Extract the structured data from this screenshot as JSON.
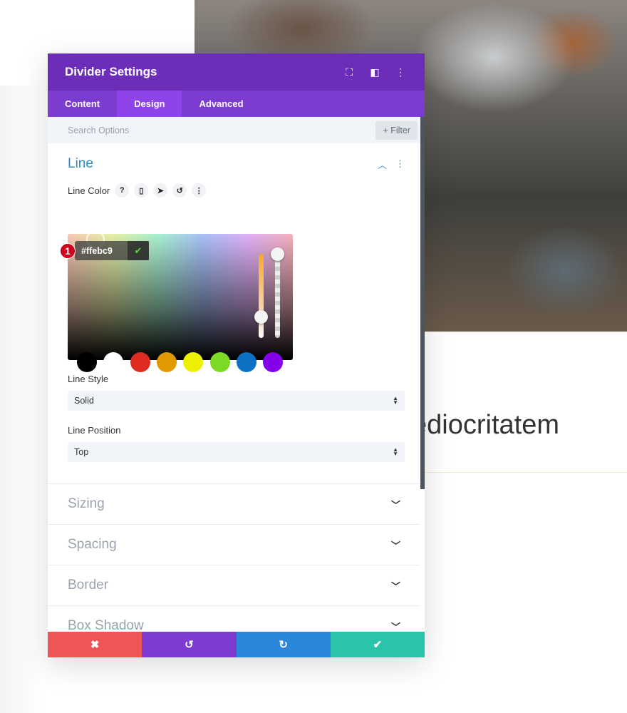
{
  "background": {
    "heading_fragment": "ediocritatem"
  },
  "panel": {
    "title": "Divider Settings",
    "header_icons": [
      "fullscreen-icon",
      "split-view-icon",
      "more-icon"
    ],
    "tabs": [
      {
        "label": "Content"
      },
      {
        "label": "Design",
        "active": true
      },
      {
        "label": "Advanced"
      }
    ],
    "search_placeholder": "Search Options",
    "filter_label": "+ Filter",
    "line_section": {
      "title": "Line",
      "line_color_label": "Line Color",
      "color_value": "#ffebc9",
      "step_badge": "1",
      "swatches": [
        "#000000",
        "#ffffff",
        "#e02b20",
        "#e09900",
        "#edf000",
        "#7cda24",
        "#0c71c3",
        "#8300e9"
      ],
      "line_style_label": "Line Style",
      "line_style_value": "Solid",
      "line_position_label": "Line Position",
      "line_position_value": "Top"
    },
    "groups": [
      {
        "label": "Sizing"
      },
      {
        "label": "Spacing"
      },
      {
        "label": "Border"
      },
      {
        "label": "Box Shadow"
      }
    ],
    "footer": {
      "cancel_color": "#ef5555",
      "undo_color": "#7d3bd0",
      "redo_color": "#2b87da",
      "save_color": "#29c4a9"
    }
  }
}
